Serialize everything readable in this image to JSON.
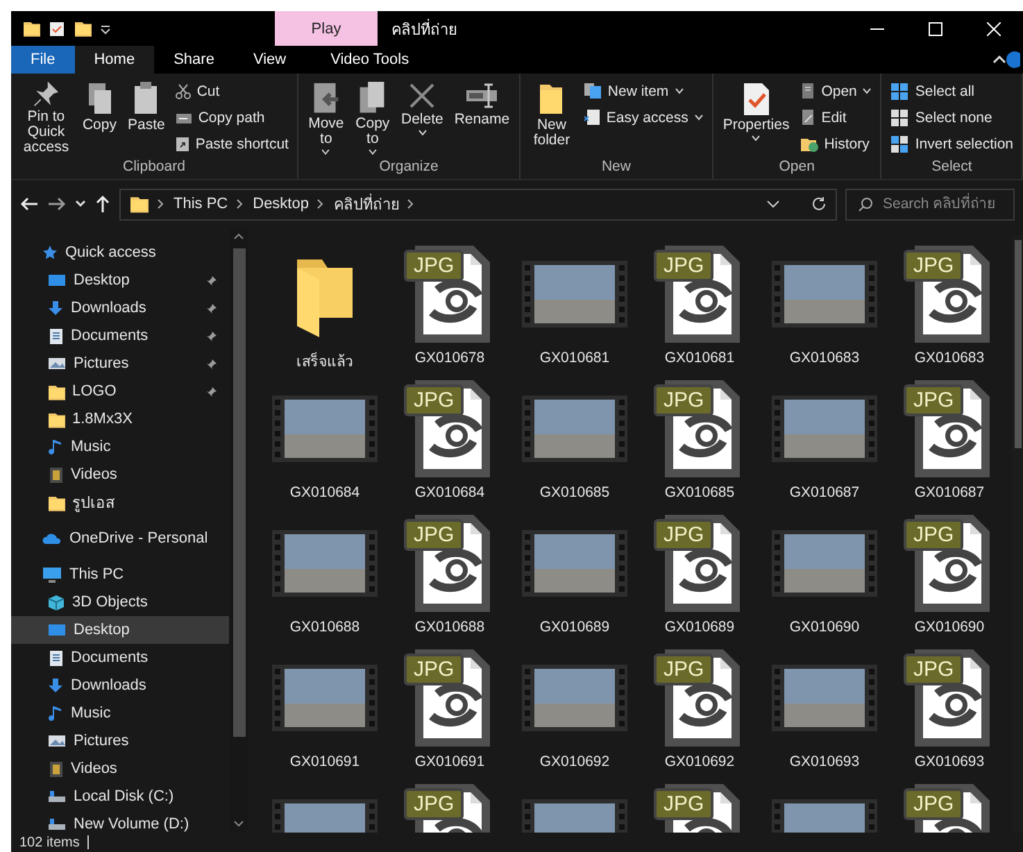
{
  "title_bar": {
    "contextual_tab": "Play",
    "title": "คลิปที่ถ่าย"
  },
  "ribbon_tabs": [
    {
      "label": "File",
      "kind": "file",
      "selected": false
    },
    {
      "label": "Home",
      "kind": "normal",
      "selected": true
    },
    {
      "label": "Share",
      "kind": "normal",
      "selected": false
    },
    {
      "label": "View",
      "kind": "normal",
      "selected": false
    },
    {
      "label": "Video Tools",
      "kind": "contextual",
      "selected": false
    }
  ],
  "ribbon_groups": [
    {
      "name": "Clipboard",
      "large": [
        {
          "label": "Pin to Quick access",
          "dropdown": false
        },
        {
          "label": "Copy",
          "dropdown": false
        },
        {
          "label": "Paste",
          "dropdown": false
        }
      ],
      "small": [
        {
          "label": "Cut",
          "dropdown": false
        },
        {
          "label": "Copy path",
          "dropdown": false
        },
        {
          "label": "Paste shortcut",
          "dropdown": false
        }
      ]
    },
    {
      "name": "Organize",
      "large": [
        {
          "label": "Move to",
          "dropdown": true
        },
        {
          "label": "Copy to",
          "dropdown": true
        },
        {
          "label": "Delete",
          "dropdown": true
        },
        {
          "label": "Rename",
          "dropdown": false
        }
      ]
    },
    {
      "name": "New",
      "large": [
        {
          "label": "New folder",
          "dropdown": false
        }
      ],
      "small": [
        {
          "label": "New item",
          "dropdown": true
        },
        {
          "label": "Easy access",
          "dropdown": true
        }
      ]
    },
    {
      "name": "Open",
      "large": [
        {
          "label": "Properties",
          "dropdown": true
        }
      ],
      "small": [
        {
          "label": "Open",
          "dropdown": true
        },
        {
          "label": "Edit",
          "dropdown": false
        },
        {
          "label": "History",
          "dropdown": false
        }
      ]
    },
    {
      "name": "Select",
      "small": [
        {
          "label": "Select all",
          "dropdown": false
        },
        {
          "label": "Select none",
          "dropdown": false
        },
        {
          "label": "Invert selection",
          "dropdown": false
        }
      ]
    }
  ],
  "address": {
    "crumbs": [
      "This PC",
      "Desktop",
      "คลิปที่ถ่าย"
    ],
    "search_placeholder": "Search คลิปที่ถ่าย"
  },
  "sidebar": [
    {
      "label": "Quick access",
      "kind": "star",
      "selected": false,
      "children": [
        {
          "label": "Desktop",
          "kind": "desktop",
          "pinned": true,
          "selected": false
        },
        {
          "label": "Downloads",
          "kind": "download",
          "pinned": true,
          "selected": false
        },
        {
          "label": "Documents",
          "kind": "document",
          "pinned": true,
          "selected": false
        },
        {
          "label": "Pictures",
          "kind": "picture",
          "pinned": true,
          "selected": false
        },
        {
          "label": "LOGO",
          "kind": "folder",
          "pinned": true,
          "selected": false
        },
        {
          "label": "1.8Mx3X",
          "kind": "folder",
          "pinned": false,
          "selected": false
        },
        {
          "label": "Music",
          "kind": "music",
          "pinned": false,
          "selected": false
        },
        {
          "label": "Videos",
          "kind": "video",
          "pinned": false,
          "selected": false
        },
        {
          "label": "รูปเอส",
          "kind": "folder",
          "pinned": false,
          "selected": false
        }
      ]
    },
    {
      "label": "OneDrive - Personal",
      "kind": "cloud",
      "selected": false
    },
    {
      "label": "This PC",
      "kind": "pc",
      "selected": false,
      "children": [
        {
          "label": "3D Objects",
          "kind": "cube",
          "pinned": false,
          "selected": false
        },
        {
          "label": "Desktop",
          "kind": "desktop",
          "pinned": false,
          "selected": true
        },
        {
          "label": "Documents",
          "kind": "document",
          "pinned": false,
          "selected": false
        },
        {
          "label": "Downloads",
          "kind": "download",
          "pinned": false,
          "selected": false
        },
        {
          "label": "Music",
          "kind": "music",
          "pinned": false,
          "selected": false
        },
        {
          "label": "Pictures",
          "kind": "picture",
          "pinned": false,
          "selected": false
        },
        {
          "label": "Videos",
          "kind": "video",
          "pinned": false,
          "selected": false
        },
        {
          "label": "Local Disk (C:)",
          "kind": "drive",
          "pinned": false,
          "selected": false
        },
        {
          "label": "New Volume (D:)",
          "kind": "drive",
          "pinned": false,
          "selected": false
        }
      ]
    }
  ],
  "files": [
    {
      "kind": "folder",
      "label": "เสร็จแล้ว"
    },
    {
      "kind": "image",
      "badge": "JPG",
      "label": "GX010678"
    },
    {
      "kind": "video",
      "label": "GX010681"
    },
    {
      "kind": "image",
      "badge": "JPG",
      "label": "GX010681"
    },
    {
      "kind": "video",
      "label": "GX010683"
    },
    {
      "kind": "image",
      "badge": "JPG",
      "label": "GX010683"
    },
    {
      "kind": "video",
      "label": "GX010684"
    },
    {
      "kind": "image",
      "badge": "JPG",
      "label": "GX010684"
    },
    {
      "kind": "video",
      "label": "GX010685"
    },
    {
      "kind": "image",
      "badge": "JPG",
      "label": "GX010685"
    },
    {
      "kind": "video",
      "label": "GX010687"
    },
    {
      "kind": "image",
      "badge": "JPG",
      "label": "GX010687"
    },
    {
      "kind": "video",
      "label": "GX010688"
    },
    {
      "kind": "image",
      "badge": "JPG",
      "label": "GX010688"
    },
    {
      "kind": "video",
      "label": "GX010689"
    },
    {
      "kind": "image",
      "badge": "JPG",
      "label": "GX010689"
    },
    {
      "kind": "video",
      "label": "GX010690"
    },
    {
      "kind": "image",
      "badge": "JPG",
      "label": "GX010690"
    },
    {
      "kind": "video",
      "label": "GX010691"
    },
    {
      "kind": "image",
      "badge": "JPG",
      "label": "GX010691"
    },
    {
      "kind": "video",
      "label": "GX010692"
    },
    {
      "kind": "image",
      "badge": "JPG",
      "label": "GX010692"
    },
    {
      "kind": "video",
      "label": "GX010693"
    },
    {
      "kind": "image",
      "badge": "JPG",
      "label": "GX010693"
    },
    {
      "kind": "video"
    },
    {
      "kind": "image",
      "badge": "JPG"
    },
    {
      "kind": "video"
    },
    {
      "kind": "image",
      "badge": "JPG"
    },
    {
      "kind": "video"
    },
    {
      "kind": "image",
      "badge": "JPG"
    }
  ],
  "status_bar": {
    "count": "102 items"
  }
}
